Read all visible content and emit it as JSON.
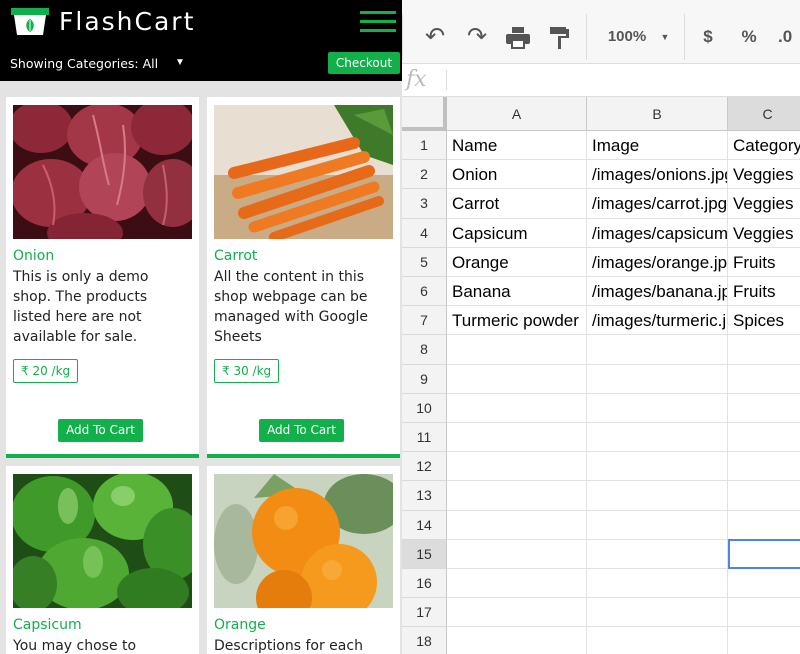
{
  "shop": {
    "brand": "FlashCart",
    "category_label": "Showing Categories: All",
    "checkout_label": "Checkout",
    "accent_color": "#11b04b",
    "products": [
      {
        "name": "Onion",
        "description": "This is only a demo shop. The products listed here are not available for sale.",
        "price": "₹ 20 /kg",
        "add_label": "Add To Cart"
      },
      {
        "name": "Carrot",
        "description": "All the content in this shop webpage can be managed with Google Sheets",
        "price": "₹ 30 /kg",
        "add_label": "Add To Cart"
      },
      {
        "name": "Capsicum",
        "description": "You may chose to"
      },
      {
        "name": "Orange",
        "description": "Descriptions for each"
      }
    ]
  },
  "sheet": {
    "zoom": "100%",
    "currency_symbol": "$",
    "percent_symbol": "%",
    "decimal_label": ".0",
    "fx_label": "fx",
    "columns": [
      "A",
      "B",
      "C"
    ],
    "row_numbers": [
      "1",
      "2",
      "3",
      "4",
      "5",
      "6",
      "7",
      "8",
      "9",
      "10",
      "11",
      "12",
      "13",
      "14",
      "15",
      "16",
      "17",
      "18"
    ],
    "rows": [
      [
        "Name",
        "Image",
        "Category"
      ],
      [
        "Onion",
        "/images/onions.jpg",
        "Veggies"
      ],
      [
        "Carrot",
        "/images/carrot.jpg",
        "Veggies"
      ],
      [
        "Capsicum",
        "/images/capsicum.jpg",
        "Veggies"
      ],
      [
        "Orange",
        "/images/orange.jpg",
        "Fruits"
      ],
      [
        "Banana",
        "/images/banana.jpg",
        "Fruits"
      ],
      [
        "Turmeric powder",
        "/images/turmeric.jpg",
        "Spices"
      ]
    ],
    "selected_cell": "C15"
  }
}
